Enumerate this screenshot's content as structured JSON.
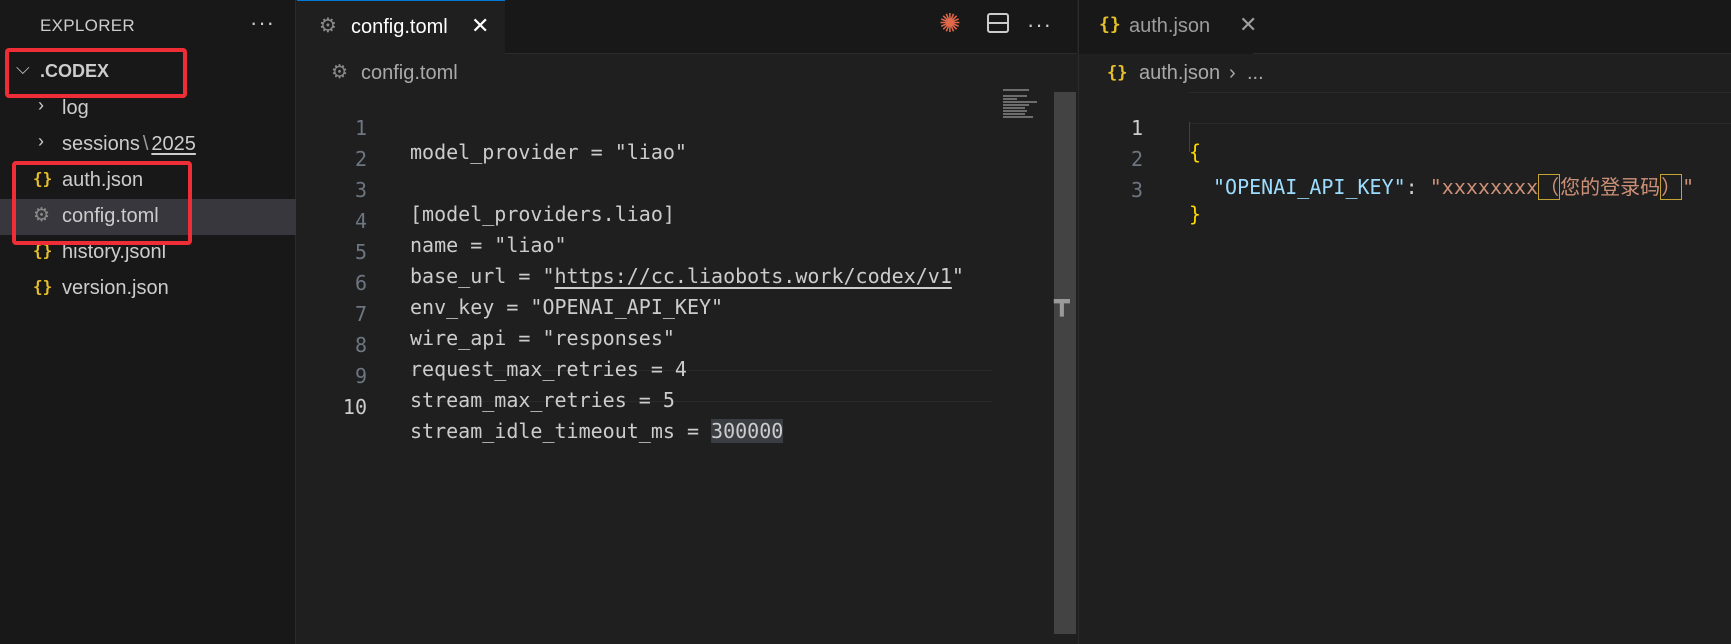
{
  "explorer": {
    "title": "EXPLORER",
    "more_icon": "ellipsis-icon",
    "folder": ".CODEX",
    "items": [
      {
        "label": "log",
        "type": "folder"
      },
      {
        "label": "sessions",
        "sub": "2025",
        "type": "folder"
      },
      {
        "label": "auth.json",
        "type": "json"
      },
      {
        "label": "config.toml",
        "type": "toml"
      },
      {
        "label": "history.jsonl",
        "type": "json"
      },
      {
        "label": "version.json",
        "type": "json"
      }
    ]
  },
  "editor1": {
    "tab_label": "config.toml",
    "breadcrumb": "config.toml",
    "lines": [
      {
        "n": "1",
        "text": "model_provider = \"liao\""
      },
      {
        "n": "2",
        "text": ""
      },
      {
        "n": "3",
        "text": "[model_providers.liao]"
      },
      {
        "n": "4",
        "text": "name = \"liao\""
      },
      {
        "n": "5",
        "prefix": "base_url = \"",
        "url": "https://cc.liaobots.work/codex/v1",
        "suffix": "\""
      },
      {
        "n": "6",
        "text": "env_key = \"OPENAI_API_KEY\""
      },
      {
        "n": "7",
        "text": "wire_api = \"responses\""
      },
      {
        "n": "8",
        "text": "request_max_retries = 4"
      },
      {
        "n": "9",
        "text": "stream_max_retries = 5"
      },
      {
        "n": "10",
        "prefix": "stream_idle_timeout_ms = ",
        "hl": "300000"
      }
    ],
    "actions": [
      "sparkle-icon",
      "split-editor-icon",
      "more-actions-icon"
    ]
  },
  "editor2": {
    "tab_label": "auth.json",
    "breadcrumb_file": "auth.json",
    "breadcrumb_rest": "...",
    "lines": [
      {
        "n": "1",
        "text": "{"
      },
      {
        "n": "2",
        "key": "\"OPENAI_API_KEY\"",
        "colon": ": ",
        "val_prefix": "\"xxxxxxxx",
        "paren_open": "（",
        "val_mid": "您的登录码",
        "paren_close": "）",
        "val_suffix": "\""
      },
      {
        "n": "3",
        "text": "}"
      }
    ]
  },
  "colors": {
    "accent_red_box": "#ef2d37",
    "json_icon": "#e5c02c",
    "json_key": "#9cdcfe",
    "json_string": "#ce9178",
    "brace": "#ffd700"
  }
}
